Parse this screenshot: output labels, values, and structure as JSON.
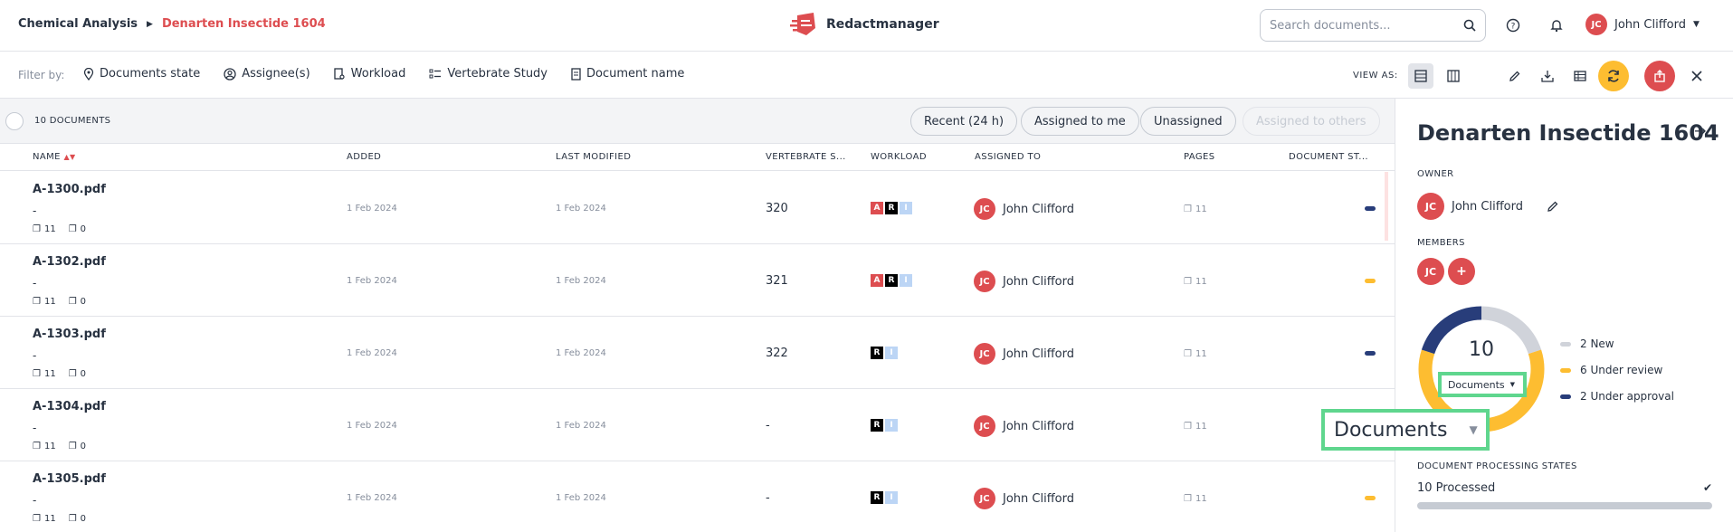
{
  "header": {
    "breadcrumb_root": "Chemical Analysis",
    "breadcrumb_current": "Denarten Insectide 1604",
    "brand_name": "Redactmanager",
    "search_placeholder": "Search documents...",
    "user_initials": "JC",
    "user_name": "John Clifford"
  },
  "filterbar": {
    "label": "Filter by:",
    "filters": [
      "Documents state",
      "Assignee(s)",
      "Workload",
      "Vertebrate Study",
      "Document name"
    ],
    "view_as_label": "VIEW AS:"
  },
  "table": {
    "count_label": "10 DOCUMENTS",
    "quick_filters": [
      "Recent (24 h)",
      "Assigned to me",
      "Unassigned",
      "Assigned to others"
    ],
    "columns": [
      "NAME",
      "ADDED",
      "LAST MODIFIED",
      "VERTEBRATE S...",
      "WORKLOAD",
      "ASSIGNED TO",
      "PAGES",
      "DOCUMENT ST..."
    ],
    "rows": [
      {
        "name": "A-1300.pdf",
        "sub": "-",
        "pages_meta": "11",
        "comments": "0",
        "added": "1 Feb 2024",
        "modified": "1 Feb 2024",
        "vertebrate": "320",
        "workload": [
          "A",
          "R",
          "I"
        ],
        "assignee_initials": "JC",
        "assignee": "John Clifford",
        "pages": "11",
        "status_color": "#283d7a"
      },
      {
        "name": "A-1302.pdf",
        "sub": "-",
        "pages_meta": "11",
        "comments": "0",
        "added": "1 Feb 2024",
        "modified": "1 Feb 2024",
        "vertebrate": "321",
        "workload": [
          "A",
          "R",
          "I"
        ],
        "assignee_initials": "JC",
        "assignee": "John Clifford",
        "pages": "11",
        "status_color": "#fdbd31"
      },
      {
        "name": "A-1303.pdf",
        "sub": "-",
        "pages_meta": "11",
        "comments": "0",
        "added": "1 Feb 2024",
        "modified": "1 Feb 2024",
        "vertebrate": "322",
        "workload": [
          "R",
          "I"
        ],
        "assignee_initials": "JC",
        "assignee": "John Clifford",
        "pages": "11",
        "status_color": "#283d7a"
      },
      {
        "name": "A-1304.pdf",
        "sub": "-",
        "pages_meta": "11",
        "comments": "0",
        "added": "1 Feb 2024",
        "modified": "1 Feb 2024",
        "vertebrate": "-",
        "workload": [
          "R",
          "I"
        ],
        "assignee_initials": "JC",
        "assignee": "John Clifford",
        "pages": "11",
        "status_color": "#fdbd31"
      },
      {
        "name": "A-1305.pdf",
        "sub": "-",
        "pages_meta": "11",
        "comments": "0",
        "added": "1 Feb 2024",
        "modified": "1 Feb 2024",
        "vertebrate": "-",
        "workload": [
          "R",
          "I"
        ],
        "assignee_initials": "JC",
        "assignee": "John Clifford",
        "pages": "11",
        "status_color": "#fdbd31"
      }
    ]
  },
  "panel": {
    "title": "Denarten Insectide 1604",
    "owner_label": "OWNER",
    "owner_initials": "JC",
    "owner_name": "John Clifford",
    "members_label": "MEMBERS",
    "member_initials": "JC",
    "add_member": "+",
    "donut_total": "10",
    "donut_select": "Documents",
    "legend": [
      {
        "label": "2 New",
        "value": 2,
        "color": "#d0d3da"
      },
      {
        "label": "6 Under review",
        "value": 6,
        "color": "#fdbd31"
      },
      {
        "label": "2 Under approval",
        "value": 2,
        "color": "#283d7a"
      }
    ],
    "zoom_label": "Documents",
    "processing_label": "DOCUMENT PROCESSING STATES",
    "processed": "10 Processed",
    "processed_fraction": 1.0
  },
  "colors": {
    "accent": "#dd4d50",
    "warning": "#fdbd31",
    "navy": "#283d7a",
    "highlight": "#5fd68e"
  }
}
